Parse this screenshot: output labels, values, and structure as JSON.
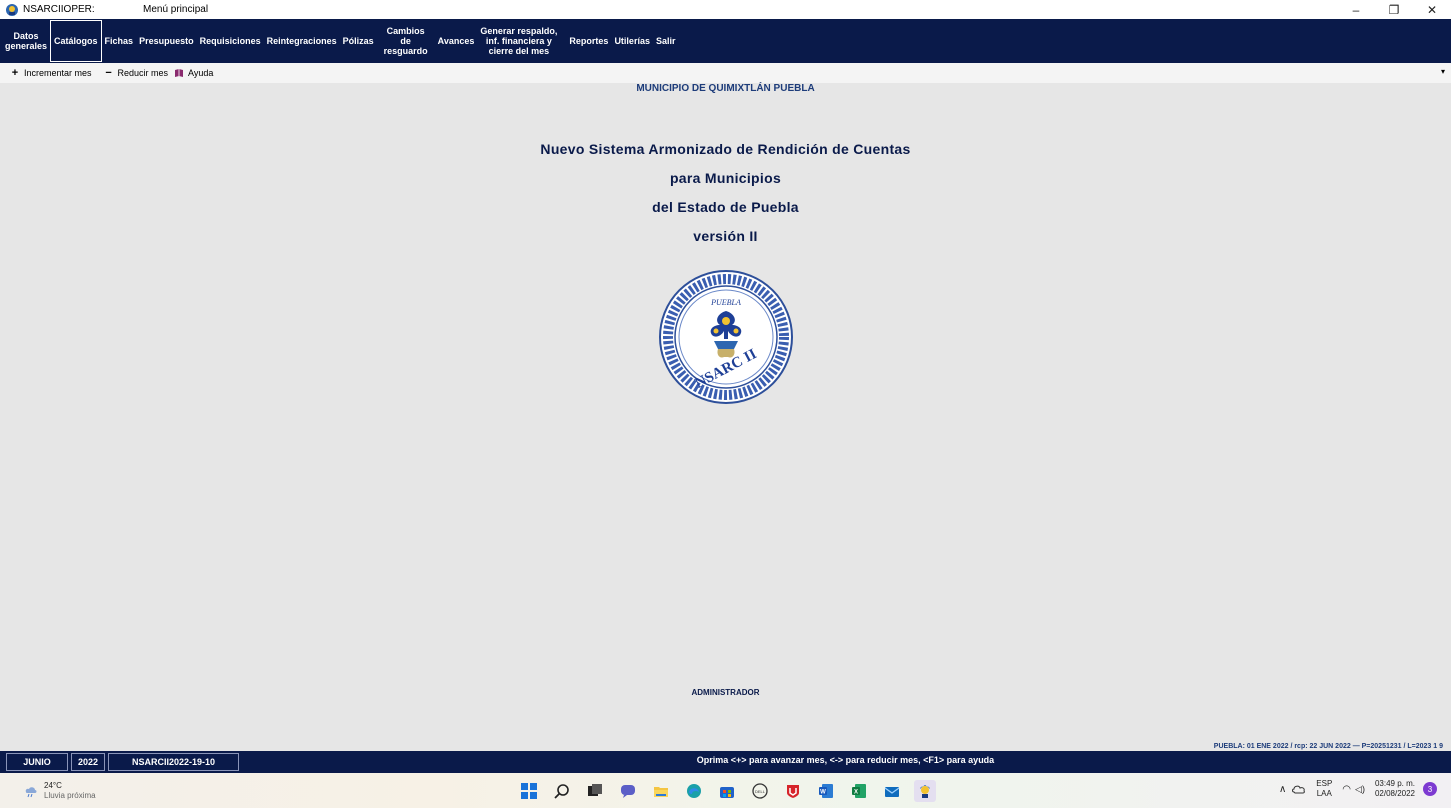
{
  "window": {
    "app_name": "NSARCIIOPER:",
    "title": "Menú principal",
    "controls": {
      "minimize": "–",
      "restore": "❐",
      "close": "✕"
    }
  },
  "menu": {
    "items": [
      {
        "label": "Datos\ngenerales"
      },
      {
        "label": "Catálogos"
      },
      {
        "label": "Fichas"
      },
      {
        "label": "Presupuesto"
      },
      {
        "label": "Requisiciones"
      },
      {
        "label": "Reintegraciones"
      },
      {
        "label": "Pólizas"
      },
      {
        "label": "Cambios\nde\nresguardo"
      },
      {
        "label": "Avances"
      },
      {
        "label": "Generar respaldo,\ninf. financiera y\ncierre del mes"
      },
      {
        "label": "Reportes"
      },
      {
        "label": "Utilerías"
      },
      {
        "label": "Salir"
      }
    ],
    "active_index": 1
  },
  "toolbar": {
    "increment": "Incrementar mes",
    "decrement": "Reducir mes",
    "help": "Ayuda"
  },
  "main": {
    "municipio": "MUNICIPIO DE QUIMIXTLÁN PUEBLA",
    "title_lines": [
      "Nuevo Sistema Armonizado de Rendición de Cuentas",
      "para Municipios",
      "del Estado de Puebla",
      "versión II"
    ],
    "logo_text_top": "PUEBLA",
    "logo_text_bottom": "NSARC II",
    "user": "ADMINISTRADOR",
    "info": "PUEBLA: 01 ENE 2022 / rcp: 22 JUN 2022  —  P=20251231 / L=2023 1 9"
  },
  "status": {
    "month": "JUNIO",
    "year": "2022",
    "version": "NSARCII2022-19-10",
    "hint": "Oprima <+> para avanzar mes, <-> para reducir mes, <F1> para ayuda"
  },
  "taskbar": {
    "weather_temp": "24°C",
    "weather_cond": "Lluvia próxima",
    "lang_top": "ESP",
    "lang_bottom": "LAA",
    "time": "03:49 p. m.",
    "date": "02/08/2022",
    "notifications": "3"
  },
  "colors": {
    "menubar": "#0a1a4a",
    "background": "#e6e6e6",
    "title_text": "#0a1a4a"
  }
}
